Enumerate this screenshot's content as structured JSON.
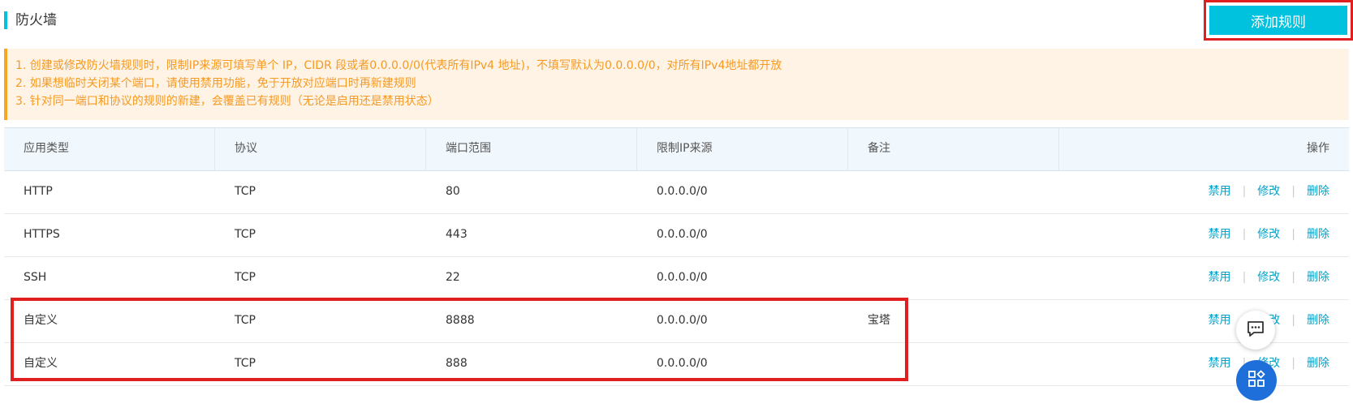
{
  "header": {
    "title": "防火墙",
    "add_button_label": "添加规则"
  },
  "notice": {
    "lines": [
      "1. 创建或修改防火墙规则时，限制IP来源可填写单个 IP，CIDR 段或者0.0.0.0/0(代表所有IPv4 地址)，不填写默认为0.0.0.0/0，对所有IPv4地址都开放",
      "2. 如果想临时关闭某个端口，请使用禁用功能，免于开放对应端口时再新建规则",
      "3. 针对同一端口和协议的规则的新建，会覆盖已有规则（无论是启用还是禁用状态）"
    ]
  },
  "table": {
    "headers": [
      "应用类型",
      "协议",
      "端口范围",
      "限制IP来源",
      "备注",
      "操作"
    ],
    "rows": [
      {
        "app": "HTTP",
        "protocol": "TCP",
        "port": "80",
        "ip": "0.0.0.0/0",
        "note": ""
      },
      {
        "app": "HTTPS",
        "protocol": "TCP",
        "port": "443",
        "ip": "0.0.0.0/0",
        "note": ""
      },
      {
        "app": "SSH",
        "protocol": "TCP",
        "port": "22",
        "ip": "0.0.0.0/0",
        "note": ""
      },
      {
        "app": "自定义",
        "protocol": "TCP",
        "port": "8888",
        "ip": "0.0.0.0/0",
        "note": "宝塔"
      },
      {
        "app": "自定义",
        "protocol": "TCP",
        "port": "888",
        "ip": "0.0.0.0/0",
        "note": ""
      }
    ],
    "actions": {
      "disable": "禁用",
      "modify": "修改",
      "delete": "删除",
      "separator": "|"
    }
  },
  "colors": {
    "accent": "#00c1de",
    "link": "#00a2ca",
    "notice_text": "#f59a23",
    "notice_bg": "#fff3e6",
    "highlight": "#e02020"
  },
  "floating": {
    "chat_icon": "chat-icon",
    "apps_icon": "apps-icon"
  }
}
